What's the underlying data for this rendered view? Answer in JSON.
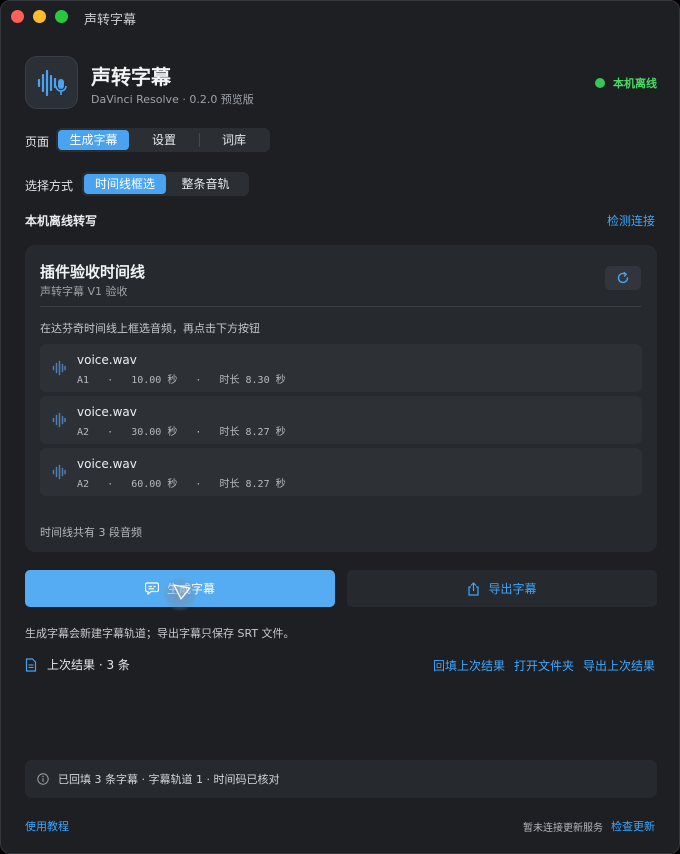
{
  "window": {
    "title": "声转字幕"
  },
  "app": {
    "name": "声转字幕",
    "subtitle": "DaVinci Resolve · 0.2.0 预览版",
    "status_label": "本机离线",
    "status_color": "#34c759",
    "icon": "waveform-mic-icon"
  },
  "page_nav": {
    "label": "页面",
    "tabs": [
      {
        "label": "生成字幕",
        "active": true
      },
      {
        "label": "设置",
        "active": false
      },
      {
        "label": "词库",
        "active": false
      }
    ]
  },
  "select_mode": {
    "label": "选择方式",
    "options": [
      {
        "label": "时间线框选",
        "active": true
      },
      {
        "label": "整条音轨",
        "active": false
      }
    ]
  },
  "engine": {
    "title": "本机离线转写",
    "detect_link": "检测连接"
  },
  "card": {
    "title": "插件验收时间线",
    "subtitle": "声转字幕 V1 验收",
    "hint": "在达芬奇时间线上框选音频，再点击下方按钮",
    "clips": [
      {
        "name": "voice.wav",
        "track": "A1",
        "start": "10.00 秒",
        "duration_label": "时长",
        "duration": "8.30 秒"
      },
      {
        "name": "voice.wav",
        "track": "A2",
        "start": "30.00 秒",
        "duration_label": "时长",
        "duration": "8.27 秒"
      },
      {
        "name": "voice.wav",
        "track": "A2",
        "start": "60.00 秒",
        "duration_label": "时长",
        "duration": "8.27 秒"
      }
    ],
    "footer": "时间线共有 3 段音频"
  },
  "actions": {
    "generate_label": "生成字幕",
    "export_label": "导出字幕",
    "accent_color": "#55acf3"
  },
  "note": "生成字幕会新建字幕轨道；导出字幕只保存 SRT 文件。",
  "last_result": {
    "label": "上次结果 · 3 条",
    "links": [
      "回填上次结果",
      "打开文件夹",
      "导出上次结果"
    ]
  },
  "banner": {
    "text": "已回填 3 条字幕 · 字幕轨道 1 · 时间码已核对"
  },
  "footer": {
    "tutorial_link": "使用教程",
    "update_status": "暂未连接更新服务",
    "check_update_link": "检查更新"
  }
}
